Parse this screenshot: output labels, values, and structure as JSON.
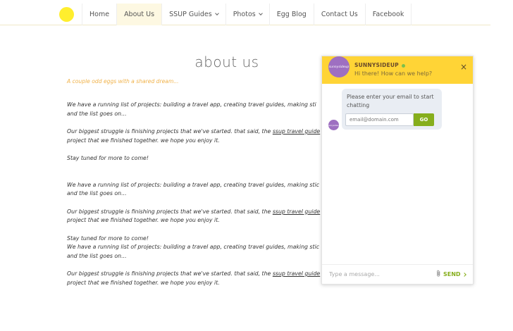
{
  "nav": {
    "items": [
      {
        "label": "Home",
        "active": false,
        "dropdown": false
      },
      {
        "label": "About Us",
        "active": true,
        "dropdown": false
      },
      {
        "label": "SSUP Guides",
        "active": false,
        "dropdown": true
      },
      {
        "label": "Photos",
        "active": false,
        "dropdown": true
      },
      {
        "label": "Egg Blog",
        "active": false,
        "dropdown": false
      },
      {
        "label": "Contact Us",
        "active": false,
        "dropdown": false
      },
      {
        "label": "Facebook",
        "active": false,
        "dropdown": false
      }
    ],
    "logo_color": "#ffee2e"
  },
  "page": {
    "title": "about us",
    "tagline": "A couple odd eggs with a shared dream...",
    "p_projects_1": "We have a running list of projects: building a travel app, creating travel guides, making sti",
    "p_projects_2": "and the list goes on...",
    "p_struggle_pre": "Our biggest struggle is finishing projects that we've started. that said, the ",
    "p_struggle_link": "ssup travel guide",
    "p_struggle_2": "project that we finished together. we hope you enjoy it.",
    "p_stay": "Stay tuned for more to come!",
    "p_projects_b1": "We have a running list of projects: building a travel app, creating travel guides, making stic",
    "p_struggle_link_b": "ssup travel guide",
    "p_struggle_b_pre": "Our biggest struggle is finishing projects that we've started. that said, the ",
    "p_projects_c1": "We have a running list of projects: building a travel app, creating travel guides, making stic"
  },
  "chat": {
    "name": "SUNNYSIDEUP",
    "greeting": "Hi there! How can we help?",
    "close_label": "×",
    "avatar_text": "sunnysideup",
    "prompt": "Please enter your email to start chatting",
    "email_placeholder": "email@domain.com",
    "go_label": "GO",
    "message_placeholder": "Type a message...",
    "send_label": "SEND",
    "status_color": "#7cc04b",
    "header_color": "#ffd436",
    "accent_color": "#86ae1c"
  }
}
